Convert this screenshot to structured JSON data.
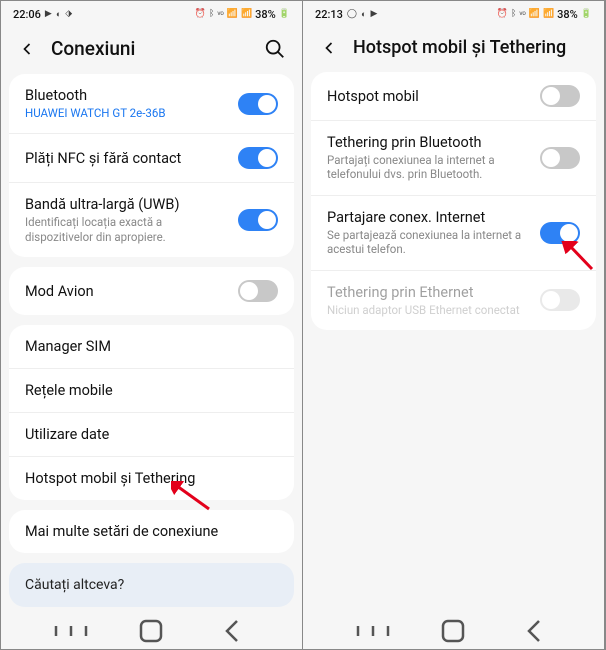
{
  "left": {
    "status": {
      "time": "22:06",
      "battery": "38%"
    },
    "header": {
      "title": "Conexiuni"
    },
    "group1": [
      {
        "title": "Bluetooth",
        "sub": "HUAWEI WATCH GT 2e-36B",
        "subBlue": true,
        "toggle": "on"
      },
      {
        "title": "Plăți NFC și fără contact",
        "toggle": "on"
      },
      {
        "title": "Bandă ultra-largă (UWB)",
        "sub": "Identificați locația exactă a dispozitivelor din apropiere.",
        "toggle": "on"
      }
    ],
    "group2": [
      {
        "title": "Mod Avion",
        "toggle": "off"
      }
    ],
    "group3": [
      {
        "title": "Manager SIM"
      },
      {
        "title": "Rețele mobile"
      },
      {
        "title": "Utilizare date"
      },
      {
        "title": "Hotspot mobil și Tethering"
      }
    ],
    "group4": [
      {
        "title": "Mai multe setări de conexiune"
      }
    ],
    "footer": "Căutați altceva?"
  },
  "right": {
    "status": {
      "time": "22:13",
      "battery": "38%"
    },
    "header": {
      "title": "Hotspot mobil și Tethering"
    },
    "group1": [
      {
        "title": "Hotspot mobil",
        "toggle": "off"
      },
      {
        "title": "Tethering prin Bluetooth",
        "sub": "Partajați conexiunea la internet a telefonului dvs. prin Bluetooth.",
        "toggle": "off"
      },
      {
        "title": "Partajare conex. Internet",
        "sub": "Se partajează conexiunea la internet a acestui telefon.",
        "toggle": "on"
      },
      {
        "title": "Tethering prin Ethernet",
        "sub": "Niciun adaptor USB Ethernet conectat",
        "toggle": "off",
        "disabled": true
      }
    ]
  }
}
